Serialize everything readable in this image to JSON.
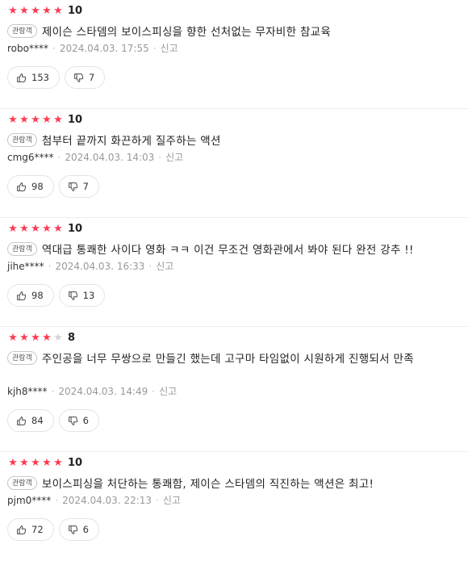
{
  "reviews": [
    {
      "stars_filled": 5,
      "rating": "10",
      "badge": "관람객",
      "text": "제이슨 스타뎀의 보이스피싱을 향한 선처없는 무자비한 참교육",
      "user": "robo****",
      "date": "2024.04.03. 17:55",
      "report_label": "신고",
      "likes": "153",
      "dislikes": "7"
    },
    {
      "stars_filled": 5,
      "rating": "10",
      "badge": "관람객",
      "text": "첨부터 끝까지 화끈하게 질주하는 액션",
      "user": "cmg6****",
      "date": "2024.04.03. 14:03",
      "report_label": "신고",
      "likes": "98",
      "dislikes": "7"
    },
    {
      "stars_filled": 5,
      "rating": "10",
      "badge": "관람객",
      "text": "역대급 통쾌한 사이다 영화 ㅋㅋ 이건 무조건 영화관에서 봐야 된다 완전 강추 !!",
      "user": "jihe****",
      "date": "2024.04.03. 16:33",
      "report_label": "신고",
      "likes": "98",
      "dislikes": "13"
    },
    {
      "stars_filled": 4,
      "rating": "8",
      "badge": "관람객",
      "text": "주인공을 너무 무쌍으로 만들긴 했는데 고구마 타임없이 시원하게 진행되서 만족",
      "user": "kjh8****",
      "date": "2024.04.03. 14:49",
      "report_label": "신고",
      "likes": "84",
      "dislikes": "6"
    },
    {
      "stars_filled": 5,
      "rating": "10",
      "badge": "관람객",
      "text": "보이스피싱을 처단하는 통쾌함, 제이슨 스타뎀의 직진하는 액션은 최고!",
      "user": "pjm0****",
      "date": "2024.04.03. 22:13",
      "report_label": "신고",
      "likes": "72",
      "dislikes": "6"
    }
  ],
  "colors": {
    "star_on": "#ff3a52",
    "star_off": "#d4d4d4",
    "meta_text": "#999999"
  },
  "icons": {
    "like": "thumbs-up-icon",
    "dislike": "thumbs-down-icon",
    "star": "star-icon"
  }
}
